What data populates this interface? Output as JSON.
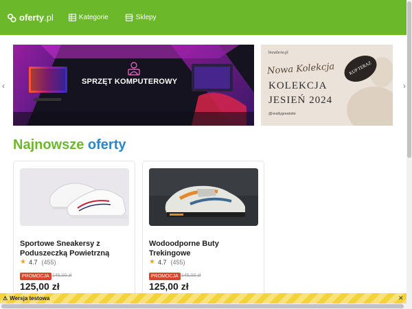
{
  "header": {
    "logo_text": "oferty",
    "logo_suffix": ".pl",
    "nav": [
      {
        "label": "Kategorie",
        "icon": "grid-icon"
      },
      {
        "label": "Sklepy",
        "icon": "shop-icon"
      }
    ],
    "color": "#6bb82a"
  },
  "banners": {
    "pc": {
      "title": "SPRZĘT KOMPUTEROWY"
    },
    "fashion": {
      "brand": "bizutleria.pl",
      "script": "Nowa Kolekcja",
      "title_line1": "KOLEKCJA",
      "title_line2": "JESIEŃ 2024",
      "social": "@reallygreatsite",
      "badge": "KUP TERAZ"
    }
  },
  "section": {
    "title_part1": "Najnowsze",
    "title_part2": "oferty"
  },
  "products": [
    {
      "name": "Sportowe Sneakersy z Poduszeczką Powietrzną",
      "rating": "4.7",
      "reviews": "(455)",
      "badge": "PROMOCJA",
      "old_price": "145,00 zł",
      "price": "125,00 zł"
    },
    {
      "name": "Wodoodporne Buty Trekingowe",
      "rating": "4.7",
      "reviews": "(455)",
      "badge": "PROMOCJA",
      "old_price": "145,00 zł",
      "price": "125,00 zł"
    }
  ],
  "test_strip": {
    "label": "Wersja testowa",
    "close": "✕"
  },
  "colors": {
    "accent_green": "#6bb82a",
    "accent_blue": "#2a86c7",
    "promo_red": "#d8452b",
    "star": "#e3a72f"
  }
}
